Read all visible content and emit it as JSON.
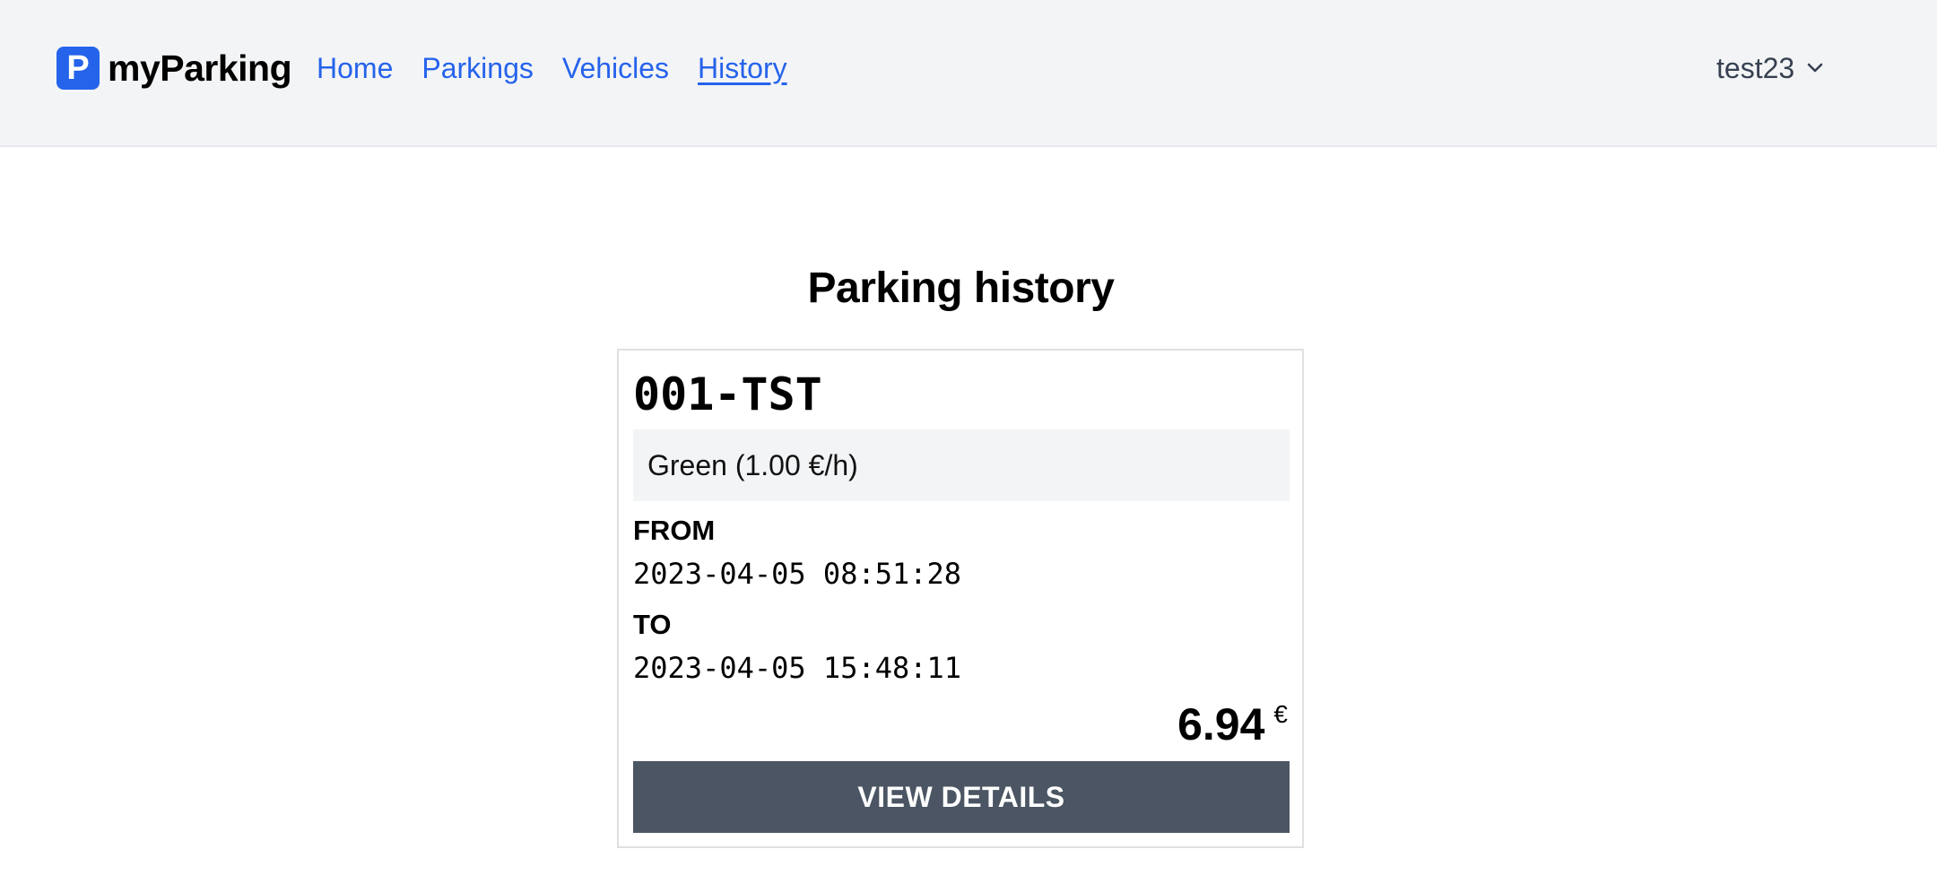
{
  "nav": {
    "brand_logo_letter": "P",
    "brand_name": "myParking",
    "links": [
      {
        "label": "Home"
      },
      {
        "label": "Parkings"
      },
      {
        "label": "Vehicles"
      },
      {
        "label": "History"
      }
    ],
    "active_link": "History",
    "user": {
      "name": "test23",
      "icon": "chevron-down-icon"
    }
  },
  "main": {
    "title": "Parking history",
    "cards": [
      {
        "plate": "001-TST",
        "zone": "Green (1.00 €/h)",
        "from_label": "FROM",
        "from_value": "2023-04-05 08:51:28",
        "to_label": "TO",
        "to_value": "2023-04-05 15:48:11",
        "price": "6.94",
        "currency": "€",
        "button_label": "VIEW DETAILS"
      }
    ]
  },
  "colors": {
    "accent": "#2563eb",
    "navbar_bg": "#f3f4f6",
    "button_bg": "#4b5563",
    "zone_bg": "#f3f4f6"
  }
}
